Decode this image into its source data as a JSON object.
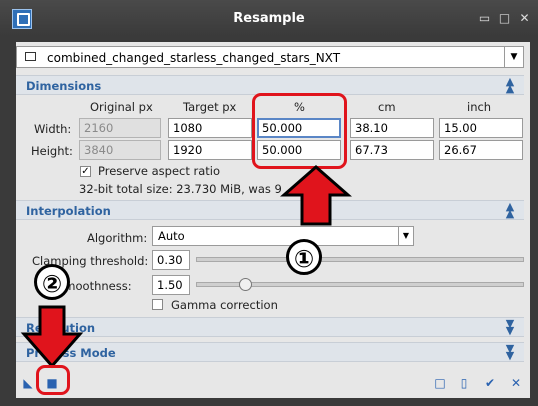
{
  "window": {
    "title": "Resample"
  },
  "view_selector": {
    "value": "combined_changed_starless_changed_stars_NXT"
  },
  "sections": {
    "dimensions": "Dimensions",
    "interpolation": "Interpolation",
    "resolution": "Resolution",
    "process_mode": "Process Mode"
  },
  "dimensions": {
    "headers": {
      "original": "Original px",
      "target": "Target px",
      "percent": "%",
      "cm": "cm",
      "inch": "inch"
    },
    "width": {
      "label": "Width:",
      "original": "2160",
      "target": "1080",
      "percent": "50.000",
      "cm": "38.10",
      "inch": "15.00"
    },
    "height": {
      "label": "Height:",
      "original": "3840",
      "target": "1920",
      "percent": "50.000",
      "cm": "67.73",
      "inch": "26.67"
    },
    "preserve_aspect": "Preserve aspect ratio",
    "total_size": "32-bit total size: 23.730 MiB, was 9"
  },
  "interpolation": {
    "algorithm_label": "Algorithm:",
    "algorithm_value": "Auto",
    "clamping_label": "Clamping threshold:",
    "clamping_value": "0.30",
    "clamping_level": 0.3,
    "smoothness_label": "Smoothness:",
    "smoothness_value": "1.50",
    "smoothness_level": 0.15,
    "gamma_label": "Gamma correction"
  },
  "annotations": {
    "one": "①",
    "two": "②"
  },
  "colors": {
    "accent": "#2f63a0",
    "annotation": "#e0141c"
  }
}
